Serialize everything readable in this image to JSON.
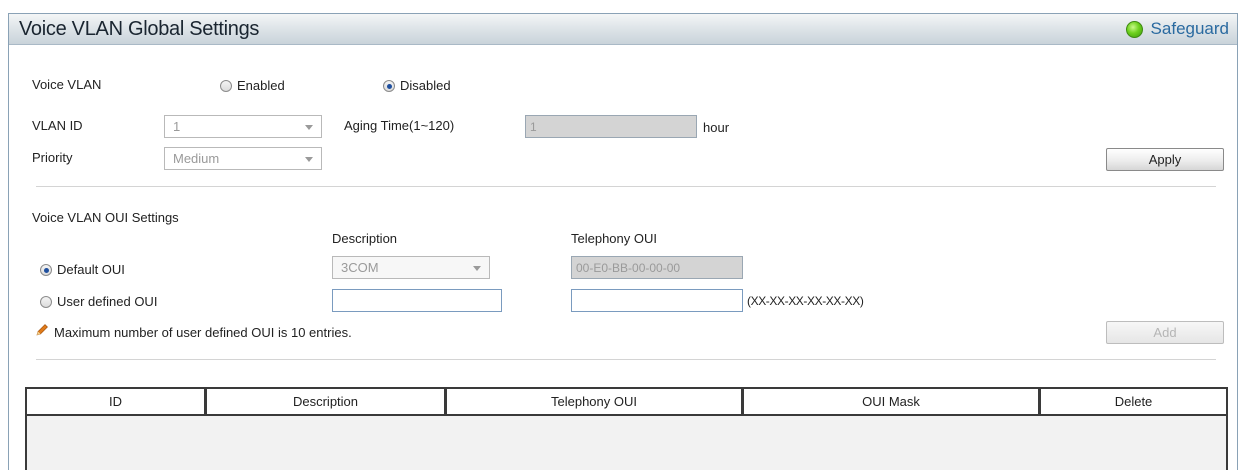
{
  "header": {
    "title": "Voice VLAN Global Settings",
    "safeguard_label": "Safeguard"
  },
  "global": {
    "voice_vlan_label": "Voice VLAN",
    "enabled_label": "Enabled",
    "disabled_label": "Disabled",
    "voice_vlan_value": "Disabled",
    "vlan_id_label": "VLAN ID",
    "vlan_id_value": "1",
    "aging_time_label": "Aging Time(1~120)",
    "aging_time_value": "1",
    "aging_unit": "hour",
    "priority_label": "Priority",
    "priority_value": "Medium",
    "apply_label": "Apply"
  },
  "oui": {
    "section_title": "Voice VLAN OUI Settings",
    "description_header": "Description",
    "telephony_header": "Telephony OUI",
    "default_oui_label": "Default OUI",
    "default_description": "3COM",
    "default_telephony": "00-E0-BB-00-00-00",
    "user_defined_label": "User defined OUI",
    "user_description": "",
    "user_telephony": "",
    "format_hint": "(XX-XX-XX-XX-XX-XX)",
    "note": "Maximum number of user defined OUI is 10 entries.",
    "add_label": "Add"
  },
  "table": {
    "columns": [
      "ID",
      "Description",
      "Telephony OUI",
      "OUI Mask",
      "Delete"
    ],
    "rows": []
  },
  "colors": {
    "title_bar": "#dfe5e9",
    "safeguard_text": "#2a6aa0",
    "safeguard_indicator": "#6ed11e"
  }
}
